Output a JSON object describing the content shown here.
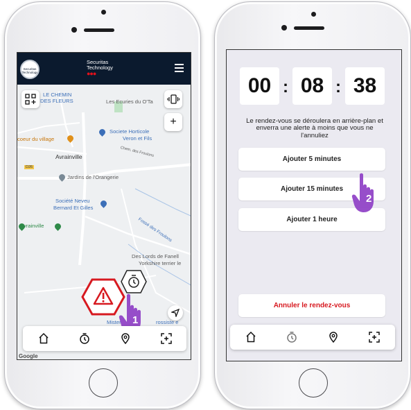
{
  "left": {
    "header": {
      "logo_text": "Securitas Technology",
      "brand_line1": "Securitas",
      "brand_line2": "Technology",
      "brand_dots": "●●●"
    },
    "map_labels": {
      "le_chemin": "LE CHEMIN",
      "des_fleurs": "DES FLEURS",
      "ecuries": "Les Ecuries du O'Ta",
      "coeur": "coeur du village",
      "societe_horticole": "Societe Horticole",
      "veron": "Veron et Fils",
      "avrainville": "Avrainville",
      "chem_froulons": "Chem. des Froulons",
      "road_d26": "D26",
      "jardins": "Jardins de l'Orangerie",
      "societe_neveu": "Société Neveu",
      "bernard": "Bernard Et Gilles",
      "avrainville_left": "Avrainville",
      "fosse": "Fossé des Froulons",
      "lords": "Des Lords de Fanell",
      "yorkshire": "Yorkshire terrier le",
      "mister": "Mister",
      "rossiste": "rossiste e",
      "google": "Google"
    },
    "controls": {
      "zoom_in": "+"
    },
    "step_number": "1"
  },
  "right": {
    "timer": {
      "hours": "00",
      "minutes": "08",
      "seconds": "38",
      "sep": ":"
    },
    "info_text": "Le rendez-vous se déroulera en arrière-plan et enverra une alerte à moins que vous ne l'annuliez",
    "buttons": {
      "add5": "Ajouter 5 minutes",
      "add15": "Ajouter 15 minutes",
      "add1h": "Ajouter 1 heure",
      "cancel": "Annuler le rendez-vous"
    },
    "step_number": "2"
  },
  "colors": {
    "accent_red": "#d71920",
    "header_navy": "#0b1a2e",
    "hand_purple": "#8e3fc5"
  },
  "tab_icons": [
    "home-icon",
    "timer-icon",
    "location-icon",
    "scan-icon"
  ]
}
